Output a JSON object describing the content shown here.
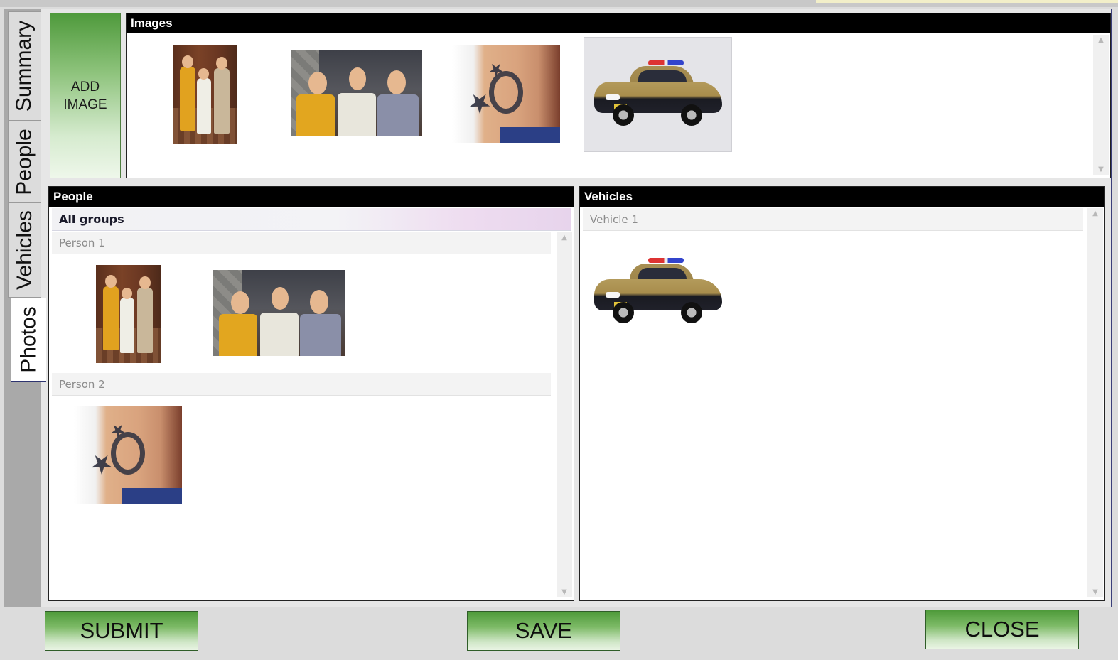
{
  "tabs": [
    {
      "label": "Summary",
      "active": false
    },
    {
      "label": "People",
      "active": false
    },
    {
      "label": "Vehicles",
      "active": false
    },
    {
      "label": "Photos",
      "active": true
    }
  ],
  "add_image": {
    "label": "ADD\nIMAGE"
  },
  "images_panel": {
    "title": "Images",
    "items": [
      {
        "kind": "family-vertical-photo"
      },
      {
        "kind": "family-horizontal-photo"
      },
      {
        "kind": "neck-tattoo-photo"
      },
      {
        "kind": "police-car-photo",
        "selected": true
      }
    ]
  },
  "people_panel": {
    "title": "People",
    "group_label": "All groups",
    "persons": [
      {
        "label": "Person 1",
        "images": [
          "family-vertical-photo",
          "family-horizontal-photo"
        ]
      },
      {
        "label": "Person 2",
        "images": [
          "neck-tattoo-photo"
        ]
      }
    ]
  },
  "vehicles_panel": {
    "title": "Vehicles",
    "vehicles": [
      {
        "label": "Vehicle 1",
        "images": [
          "police-car-photo"
        ]
      }
    ]
  },
  "buttons": {
    "submit": "SUBMIT",
    "save": "SAVE",
    "close": "CLOSE"
  },
  "colors": {
    "panel_header": "#000000",
    "button_green": "#4e9a3a",
    "frame_border": "#3a3f7a"
  }
}
